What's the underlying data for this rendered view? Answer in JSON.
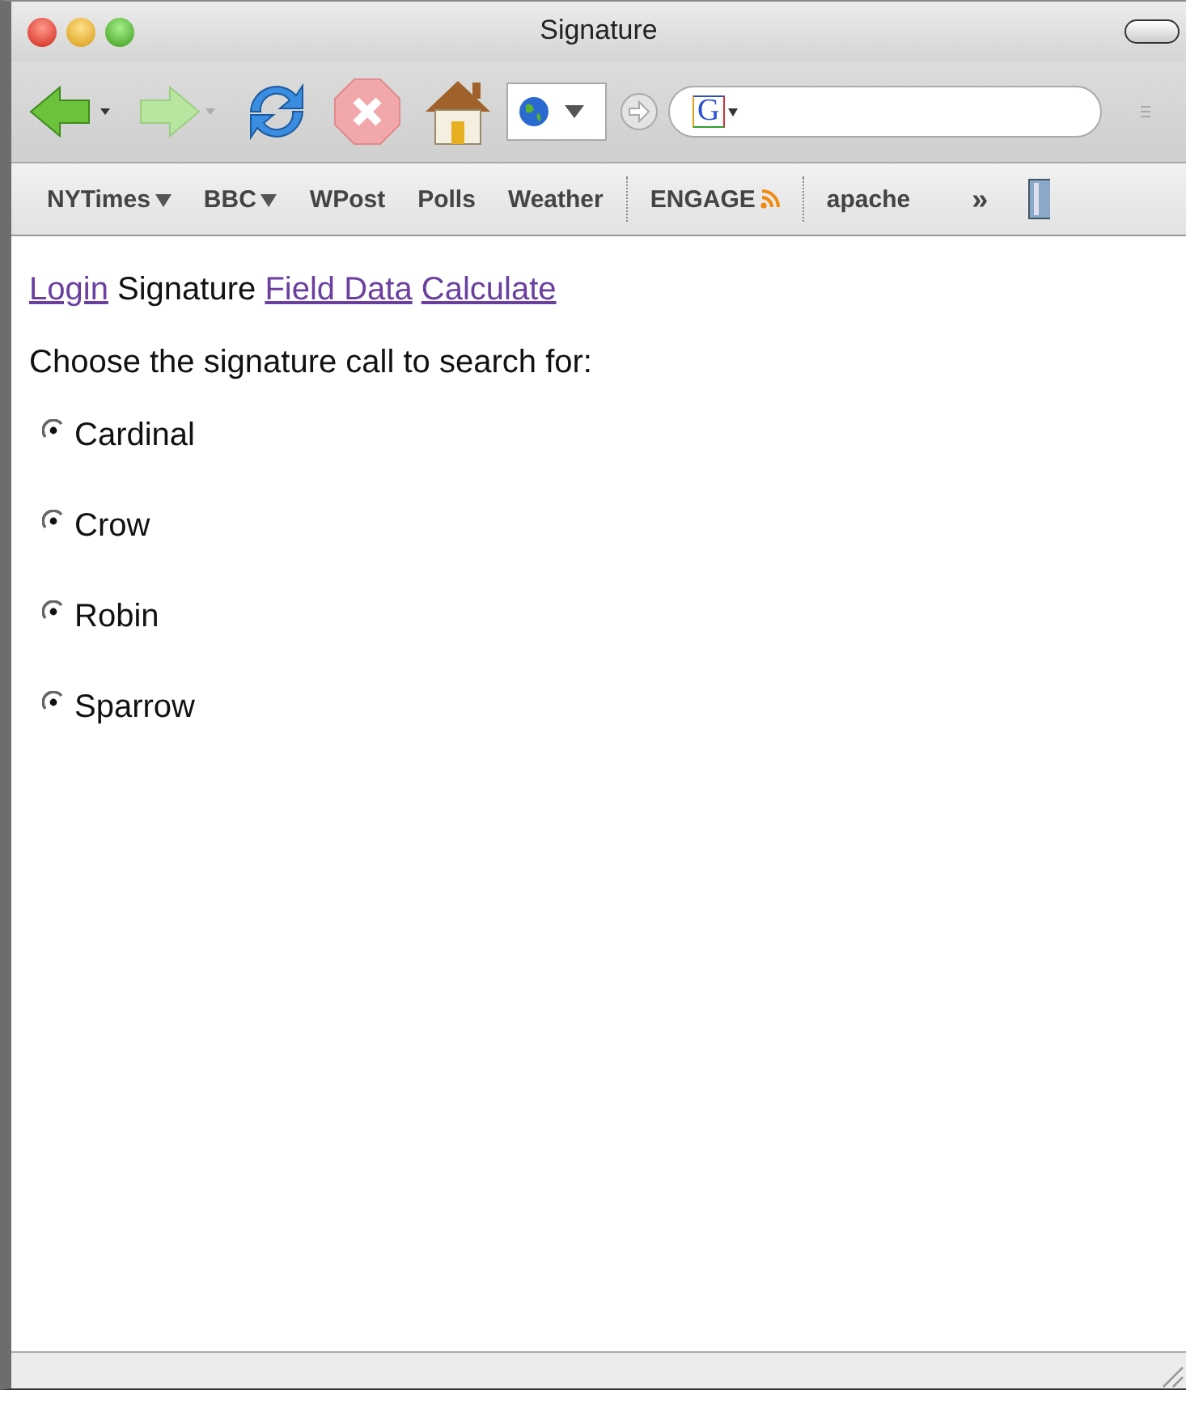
{
  "window": {
    "title": "Signature"
  },
  "toolbar": {
    "search": {
      "engine_letter": "G"
    }
  },
  "bookmarks": [
    {
      "kind": "menu",
      "label": "NYTimes"
    },
    {
      "kind": "menu",
      "label": "BBC"
    },
    {
      "kind": "link",
      "label": "WPost"
    },
    {
      "kind": "link",
      "label": "Polls"
    },
    {
      "kind": "link",
      "label": "Weather"
    },
    {
      "kind": "separator"
    },
    {
      "kind": "feed",
      "label": "ENGAGE"
    },
    {
      "kind": "separator"
    },
    {
      "kind": "link",
      "label": "apache"
    },
    {
      "kind": "more",
      "label": "»"
    }
  ],
  "nav": [
    {
      "kind": "link",
      "text": "Login"
    },
    {
      "kind": "current",
      "text": "Signature"
    },
    {
      "kind": "link",
      "text": "Field Data"
    },
    {
      "kind": "link",
      "text": "Calculate"
    }
  ],
  "prompt": "Choose the signature call to search for:",
  "options": [
    {
      "label": "Cardinal",
      "selected": true
    },
    {
      "label": "Crow",
      "selected": true
    },
    {
      "label": "Robin",
      "selected": true
    },
    {
      "label": "Sparrow",
      "selected": true
    }
  ]
}
